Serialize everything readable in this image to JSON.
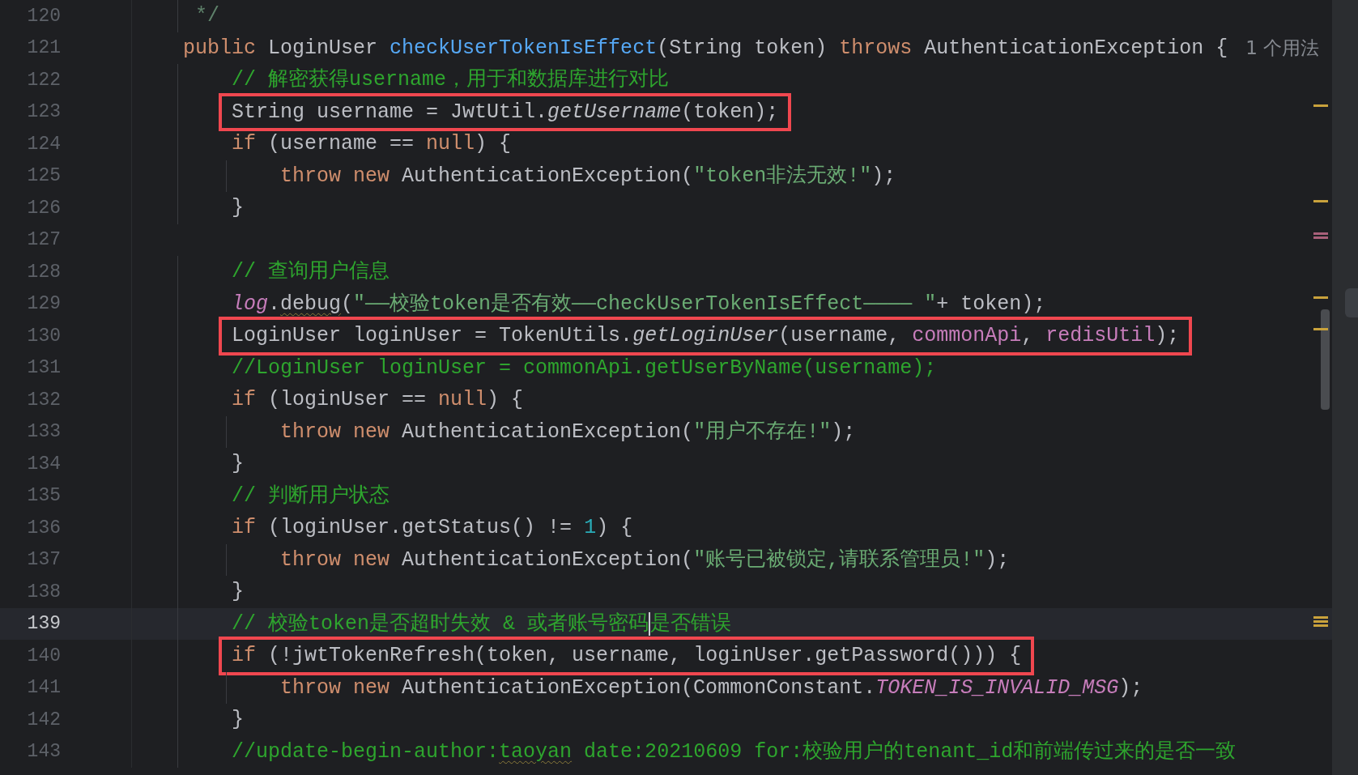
{
  "editor": {
    "lines": [
      {
        "number": "120",
        "tokens": [
          {
            "kind": "doc",
            "text": "     */"
          }
        ]
      },
      {
        "number": "121",
        "tokens": [
          {
            "kind": "kw",
            "text": "    public "
          },
          {
            "kind": "plain",
            "text": "LoginUser "
          },
          {
            "kind": "decl",
            "text": "checkUserTokenIsEffect"
          },
          {
            "kind": "plain",
            "text": "(String token) "
          },
          {
            "kind": "kw",
            "text": "throws "
          },
          {
            "kind": "plain",
            "text": "AuthenticationException {"
          }
        ],
        "hint": "1 个用法"
      },
      {
        "number": "122",
        "tokens": [
          {
            "kind": "comment",
            "text": "        // 解密获得username，用于和数据库进行对比"
          }
        ]
      },
      {
        "number": "123",
        "boxed": true,
        "stripe_mark": {
          "kind": "single",
          "color": "#c9a23c"
        },
        "tokens": [
          {
            "kind": "plain",
            "text": "        String username = JwtUtil."
          },
          {
            "kind": "method",
            "text": "getUsername"
          },
          {
            "kind": "plain",
            "text": "(token);"
          }
        ]
      },
      {
        "number": "124",
        "tokens": [
          {
            "kind": "kw",
            "text": "        if "
          },
          {
            "kind": "plain",
            "text": "(username == "
          },
          {
            "kind": "kw",
            "text": "null"
          },
          {
            "kind": "plain",
            "text": ") {"
          }
        ]
      },
      {
        "number": "125",
        "tokens": [
          {
            "kind": "kw",
            "text": "            throw new "
          },
          {
            "kind": "plain",
            "text": "AuthenticationException("
          },
          {
            "kind": "string",
            "text": "\"token非法无效!\""
          },
          {
            "kind": "plain",
            "text": ");"
          }
        ]
      },
      {
        "number": "126",
        "stripe_mark": {
          "kind": "single",
          "color": "#c9a23c"
        },
        "tokens": [
          {
            "kind": "plain",
            "text": "        }"
          }
        ]
      },
      {
        "number": "127",
        "stripe_mark": {
          "kind": "double",
          "color": "#a8607a"
        }
      },
      {
        "number": "128",
        "tokens": [
          {
            "kind": "comment",
            "text": "        // 查询用户信息"
          }
        ]
      },
      {
        "number": "129",
        "stripe_mark": {
          "kind": "single",
          "color": "#c9a23c"
        },
        "tokens": [
          {
            "kind": "static",
            "text": "        log"
          },
          {
            "kind": "plain",
            "text": "."
          },
          {
            "kind": "plain",
            "text": "debug",
            "squiggly": true
          },
          {
            "kind": "plain",
            "text": "("
          },
          {
            "kind": "string",
            "text": "\"——校验token是否有效——checkUserTokenIsEffect———— \""
          },
          {
            "kind": "plain",
            "text": "+ token);"
          }
        ]
      },
      {
        "number": "130",
        "boxed": true,
        "stripe_mark": {
          "kind": "single",
          "color": "#c9a23c"
        },
        "tokens": [
          {
            "kind": "plain",
            "text": "        LoginUser loginUser = TokenUtils."
          },
          {
            "kind": "method",
            "text": "getLoginUser"
          },
          {
            "kind": "plain",
            "text": "(username, "
          },
          {
            "kind": "field",
            "text": "commonApi"
          },
          {
            "kind": "plain",
            "text": ", "
          },
          {
            "kind": "field",
            "text": "redisUtil"
          },
          {
            "kind": "plain",
            "text": ");"
          }
        ]
      },
      {
        "number": "131",
        "tokens": [
          {
            "kind": "comment",
            "text": "        //LoginUser loginUser = commonApi.getUserByName(username);"
          }
        ]
      },
      {
        "number": "132",
        "tokens": [
          {
            "kind": "kw",
            "text": "        if "
          },
          {
            "kind": "plain",
            "text": "(loginUser == "
          },
          {
            "kind": "kw",
            "text": "null"
          },
          {
            "kind": "plain",
            "text": ") {"
          }
        ]
      },
      {
        "number": "133",
        "tokens": [
          {
            "kind": "kw",
            "text": "            throw new "
          },
          {
            "kind": "plain",
            "text": "AuthenticationException("
          },
          {
            "kind": "string",
            "text": "\"用户不存在!\""
          },
          {
            "kind": "plain",
            "text": ");"
          }
        ]
      },
      {
        "number": "134",
        "tokens": [
          {
            "kind": "plain",
            "text": "        }"
          }
        ]
      },
      {
        "number": "135",
        "tokens": [
          {
            "kind": "comment",
            "text": "        // 判断用户状态"
          }
        ]
      },
      {
        "number": "136",
        "tokens": [
          {
            "kind": "kw",
            "text": "        if "
          },
          {
            "kind": "plain",
            "text": "(loginUser.getStatus() != "
          },
          {
            "kind": "num",
            "text": "1"
          },
          {
            "kind": "plain",
            "text": ") {"
          }
        ]
      },
      {
        "number": "137",
        "tokens": [
          {
            "kind": "kw",
            "text": "            throw new "
          },
          {
            "kind": "plain",
            "text": "AuthenticationException("
          },
          {
            "kind": "string",
            "text": "\"账号已被锁定,请联系管理员!\""
          },
          {
            "kind": "plain",
            "text": ");"
          }
        ]
      },
      {
        "number": "138",
        "tokens": [
          {
            "kind": "plain",
            "text": "        }"
          }
        ]
      },
      {
        "number": "139",
        "current": true,
        "stripe_mark": {
          "kind": "triple",
          "color": "#c9a23c"
        },
        "tokens": [
          {
            "kind": "comment",
            "text": "        // 校验token是否超时失效 & 或者账号密码"
          },
          {
            "kind": "comment",
            "text": "是否错误",
            "caret_before": true
          }
        ]
      },
      {
        "number": "140",
        "boxed": true,
        "tokens": [
          {
            "kind": "kw",
            "text": "        if "
          },
          {
            "kind": "plain",
            "text": "(!jwtTokenRefresh(token, username, loginUser.getPassword())) {"
          }
        ]
      },
      {
        "number": "141",
        "tokens": [
          {
            "kind": "kw",
            "text": "            throw new "
          },
          {
            "kind": "plain",
            "text": "AuthenticationException(CommonConstant."
          },
          {
            "kind": "static",
            "text": "TOKEN_IS_INVALID_MSG"
          },
          {
            "kind": "plain",
            "text": ");"
          }
        ]
      },
      {
        "number": "142",
        "tokens": [
          {
            "kind": "plain",
            "text": "        }"
          }
        ]
      },
      {
        "number": "143",
        "tokens": [
          {
            "kind": "comment",
            "text": "        //update-begin-author:"
          },
          {
            "kind": "comment",
            "text": "taoyan",
            "squiggly": true
          },
          {
            "kind": "comment",
            "text": " date:20210609 for:校验用户的tenant_id和前端传过来的是否一致"
          }
        ]
      }
    ]
  }
}
